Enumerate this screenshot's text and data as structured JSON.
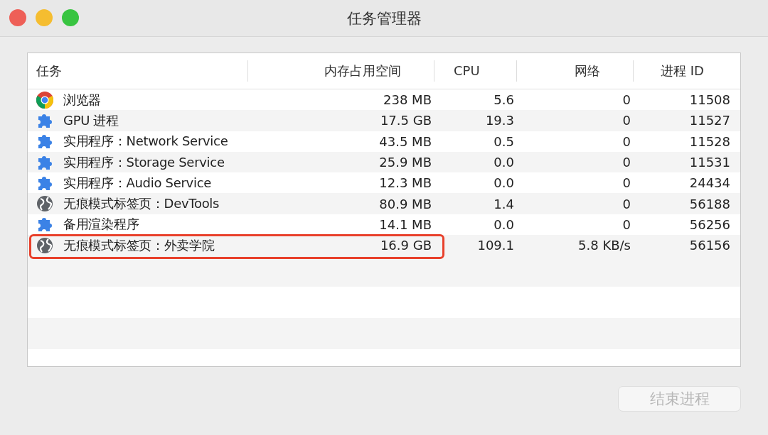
{
  "window": {
    "title": "任务管理器"
  },
  "table": {
    "columns": [
      "任务",
      "内存占用空间",
      "CPU",
      "网络",
      "进程 ID"
    ],
    "rows": [
      {
        "kind": "chrome",
        "task": "浏览器",
        "memory": "238 MB",
        "cpu": "5.6",
        "network": "0",
        "pid": "11508",
        "highlighted": false
      },
      {
        "kind": "puzzle",
        "task": "GPU 进程",
        "memory": "17.5 GB",
        "cpu": "19.3",
        "network": "0",
        "pid": "11527",
        "highlighted": false
      },
      {
        "kind": "puzzle",
        "task": "实用程序：Network Service",
        "memory": "43.5 MB",
        "cpu": "0.5",
        "network": "0",
        "pid": "11528",
        "highlighted": false
      },
      {
        "kind": "puzzle",
        "task": "实用程序：Storage Service",
        "memory": "25.9 MB",
        "cpu": "0.0",
        "network": "0",
        "pid": "11531",
        "highlighted": false
      },
      {
        "kind": "puzzle",
        "task": "实用程序：Audio Service",
        "memory": "12.3 MB",
        "cpu": "0.0",
        "network": "0",
        "pid": "24434",
        "highlighted": false
      },
      {
        "kind": "globe",
        "task": "无痕模式标签页：DevTools",
        "memory": "80.9 MB",
        "cpu": "1.4",
        "network": "0",
        "pid": "56188",
        "highlighted": false
      },
      {
        "kind": "puzzle",
        "task": "备用渲染程序",
        "memory": "14.1 MB",
        "cpu": "0.0",
        "network": "0",
        "pid": "56256",
        "highlighted": false
      },
      {
        "kind": "globe",
        "task": "无痕模式标签页：外卖学院",
        "memory": "16.9 GB",
        "cpu": "109.1",
        "network": "5.8 KB/s",
        "pid": "56156",
        "highlighted": true
      }
    ]
  },
  "end_button": {
    "label": "结束进程",
    "disabled": true
  }
}
